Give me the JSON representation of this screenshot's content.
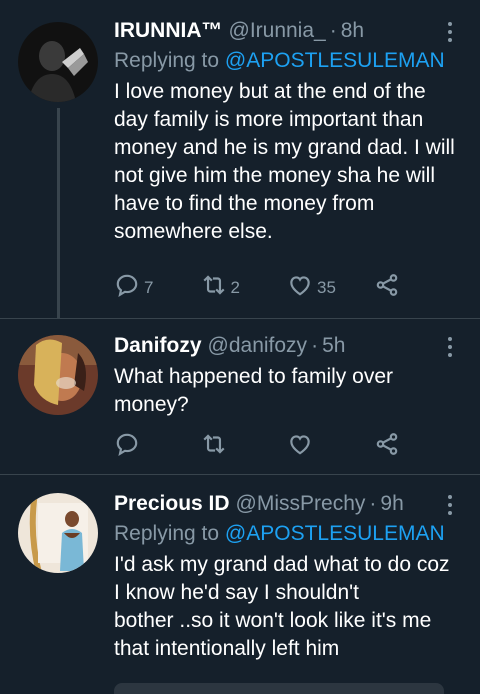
{
  "tweets": [
    {
      "name": "IRUNNIA™",
      "handle": "@Irunnia_",
      "separator": "·",
      "time": "8h",
      "replying_label": "Replying to",
      "replying_to": "@APOSTLESULEMAN",
      "lines": [
        "I love money but at the end of the",
        "day family is more important than",
        "money and he is my grand dad. I will",
        "not give him the money sha he will",
        "have to find the money from",
        "somewhere else."
      ],
      "replies": "7",
      "retweets": "2",
      "likes": "35"
    },
    {
      "name": "Danifozy",
      "handle": "@danifozy",
      "separator": "·",
      "time": "5h",
      "lines": [
        "What happened to family over",
        "money?"
      ]
    },
    {
      "name": "Precious ID",
      "handle": "@MissPrechy",
      "separator": "·",
      "time": "9h",
      "replying_label": "Replying to",
      "replying_to": "@APOSTLESULEMAN",
      "lines": [
        "I'd ask my grand dad what to do coz",
        "I know he'd say I shouldn't",
        "bother ..so it won't look like it's me",
        "that intentionally left him"
      ]
    }
  ],
  "icons": {
    "reply": "reply-icon",
    "retweet": "retweet-icon",
    "like": "heart-icon",
    "share": "share-icon",
    "more": "more-options-icon"
  },
  "colors": {
    "background": "#15202b",
    "divider": "#38444d",
    "muted": "#8899a6",
    "accent": "#1da1f2"
  }
}
